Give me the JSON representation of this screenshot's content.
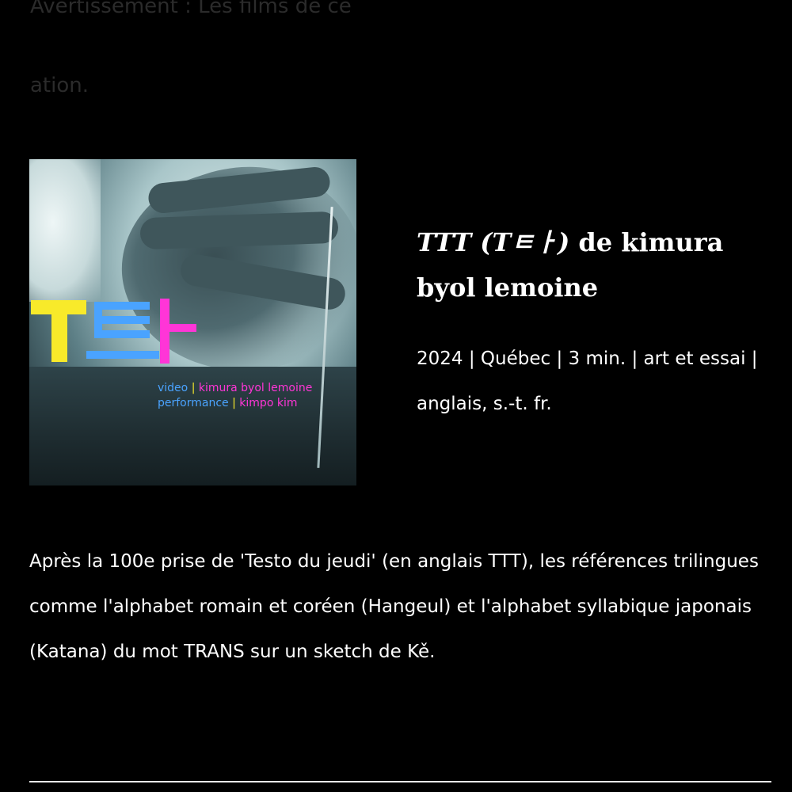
{
  "previous_entry": {
    "line1": "Avertissement : Les films de ce",
    "line2": "ation."
  },
  "film": {
    "poster": {
      "glyph_text": "TEㅏ",
      "credit_line1_role": "video",
      "credit_line1_name": "kimura byol lemoine",
      "credit_line2_role": "performance",
      "credit_line2_name": "kimpo kim",
      "separator": "|"
    },
    "title_italic": "TTT (Tㅌㅏ)",
    "title_rest": " de kimura byol lemoine",
    "meta": "2024 | Québec | 3 min. | art et essai | anglais, s.-t. fr.",
    "description": "Après la 100e prise de 'Testo du jeudi' (en anglais TTT), les références trilingues comme l'alphabet romain et coréen (Hangeul) et l'alphabet syllabique japonais (Katana) du mot TRANS sur un sketch de Kě."
  },
  "colors": {
    "background": "#000000",
    "text": "#ffffff",
    "glyph_yellow": "#f8ea2a",
    "glyph_blue": "#4aa3ff",
    "glyph_pink": "#ff35d7"
  }
}
